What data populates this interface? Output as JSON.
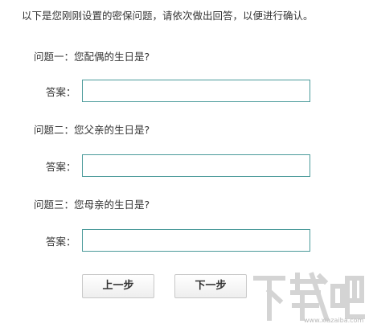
{
  "intro": "以下是您刚刚设置的密保问题，请依次做出回答，以便进行确认。",
  "questions": [
    {
      "label": "问题一：",
      "text": "您配偶的生日是?",
      "answer_label": "答案：",
      "answer_value": ""
    },
    {
      "label": "问题二：",
      "text": "您父亲的生日是?",
      "answer_label": "答案：",
      "answer_value": ""
    },
    {
      "label": "问题三：",
      "text": "您母亲的生日是?",
      "answer_label": "答案：",
      "answer_value": ""
    }
  ],
  "buttons": {
    "prev": "上一步",
    "next": "下一步"
  },
  "watermark": {
    "text": "下载吧",
    "site": "www.xiazaiba.com"
  },
  "colors": {
    "input_border": "#4a9a9a",
    "text": "#333333",
    "button_border": "#c8c8c8"
  }
}
